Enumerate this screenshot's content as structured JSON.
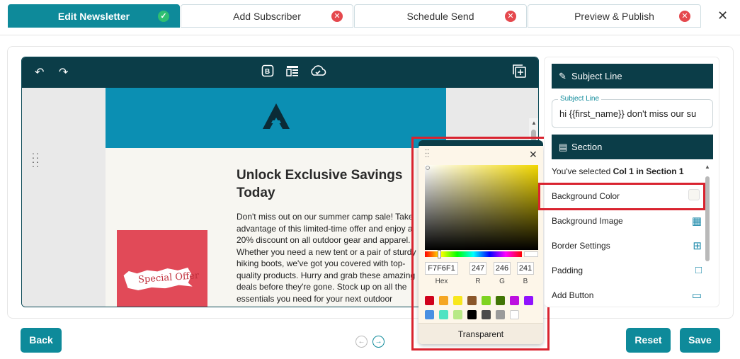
{
  "tabs": [
    {
      "label": "Edit Newsletter",
      "status": "✓"
    },
    {
      "label": "Add Subscriber",
      "status": "✕"
    },
    {
      "label": "Schedule Send",
      "status": "✕"
    },
    {
      "label": "Preview & Publish",
      "status": "✕"
    }
  ],
  "close": "✕",
  "editor": {
    "heading": "Unlock Exclusive Savings Today",
    "paragraph": "Don't miss out on our summer camp sale! Take advantage of this limited-time offer and enjoy a 20% discount on all outdoor gear and apparel. Whether you need a new tent or a pair of sturdy hiking boots, we've got you covered with top-quality products. Hurry and grab these amazing deals before they're gone. Stock up on all the essentials you need for your next outdoor",
    "image_text": "Special Offer"
  },
  "picker": {
    "hex": "F7F6F1",
    "r": "247",
    "g": "246",
    "b": "241",
    "hex_label": "Hex",
    "r_label": "R",
    "g_label": "G",
    "b_label": "B",
    "transparent": "Transparent",
    "swatches": [
      "#d0021b",
      "#f5a623",
      "#f8e71c",
      "#8b572a",
      "#7ed321",
      "#417505",
      "#bd10e0",
      "#9013fe",
      "#4a90e2",
      "#50e3c2",
      "#b8e986",
      "#000000",
      "#4a4a4a",
      "#9b9b9b",
      "#ffffff"
    ]
  },
  "panel": {
    "subject_header": "Subject Line",
    "subject_label": "Subject Line",
    "subject_value": "hi {{first_name}} don't miss our su",
    "section_header": "Section",
    "selected_prefix": "You've selected ",
    "selected_bold": "Col 1 in Section 1",
    "rows": [
      "Background Color",
      "Background Image",
      "Border Settings",
      "Padding",
      "Add Button"
    ]
  },
  "buttons": {
    "back": "Back",
    "reset": "Reset",
    "save": "Save"
  }
}
